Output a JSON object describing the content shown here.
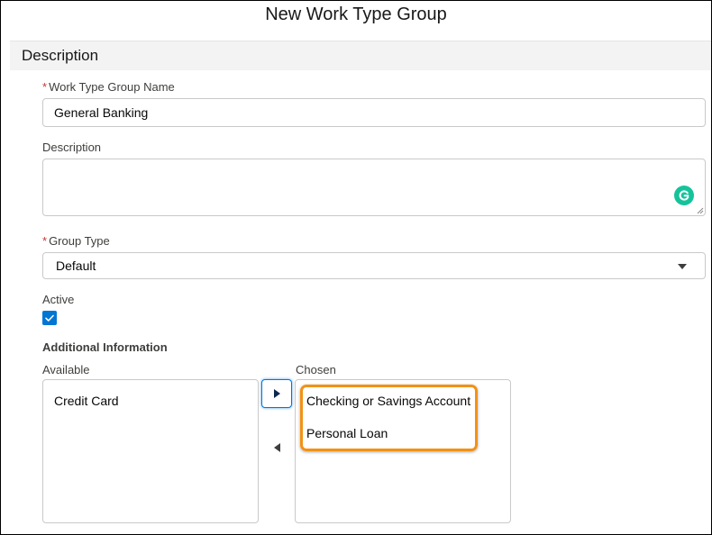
{
  "modal": {
    "title": "New Work Type Group"
  },
  "section": {
    "title": "Description"
  },
  "fields": {
    "name": {
      "label": "Work Type Group Name",
      "required_mark": "*",
      "value": "General Banking"
    },
    "description": {
      "label": "Description",
      "value": ""
    },
    "group_type": {
      "label": "Group Type",
      "required_mark": "*",
      "selected": "Default"
    },
    "active": {
      "label": "Active",
      "checked": true
    }
  },
  "additional_info": {
    "title": "Additional Information",
    "available": {
      "label": "Available",
      "items": [
        "Credit Card"
      ]
    },
    "chosen": {
      "label": "Chosen",
      "items": [
        "Checking or Savings Account",
        "Personal Loan"
      ]
    }
  },
  "colors": {
    "accent": "#0176d3",
    "required": "#c23934",
    "highlight": "#f29215",
    "grammarly": "#15c39a"
  },
  "icons": {
    "grammarly": "grammarly-icon",
    "dropdown": "chevron-down-icon",
    "checkbox": "check-icon",
    "move_right": "triangle-right-icon",
    "move_left": "triangle-left-icon"
  }
}
